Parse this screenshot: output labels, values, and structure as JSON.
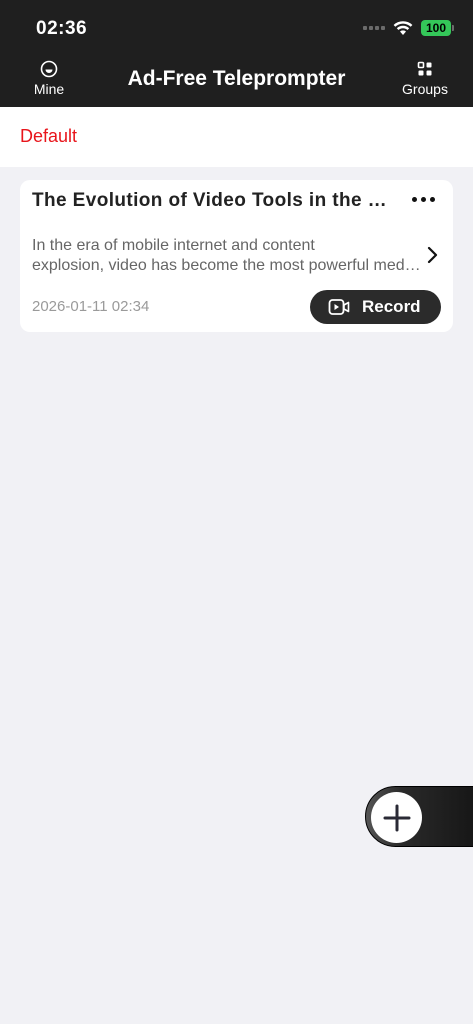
{
  "status_bar": {
    "time": "02:36",
    "battery": "100"
  },
  "header": {
    "title": "Ad-Free Teleprompter",
    "left_label": "Mine",
    "right_label": "Groups"
  },
  "group": {
    "name": "Default"
  },
  "scripts": [
    {
      "title": "The Evolution of Video Tools in the Mobile Era",
      "preview_line1": "In the era of mobile internet and content",
      "preview_line2": "explosion, video has become the most powerful medium",
      "date": "2026-01-11 02:34",
      "record_label": "Record"
    }
  ],
  "icons": {
    "mine": "smile-face-icon",
    "groups": "grid-icon",
    "more": "more-dots-icon",
    "chevron": "chevron-right-icon",
    "record": "video-camera-icon",
    "add": "plus-icon"
  },
  "colors": {
    "header_bg": "#1f1f1f",
    "group_accent": "#e8151b",
    "battery": "#34c759",
    "page_bg": "#f1f1f5"
  }
}
